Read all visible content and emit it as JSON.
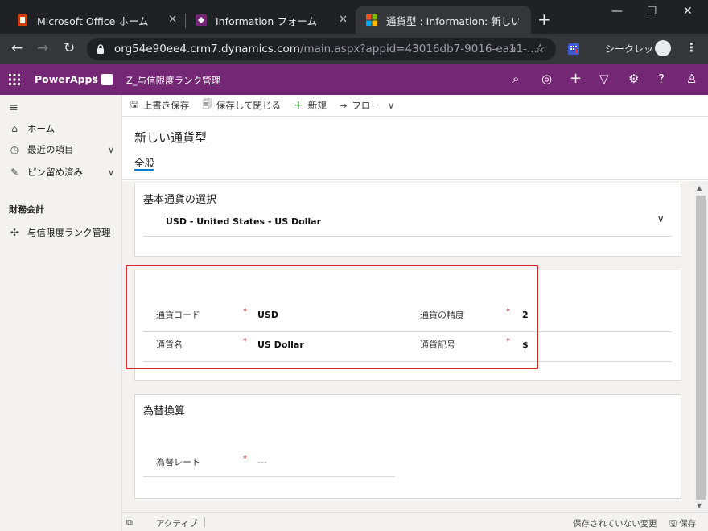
{
  "browser": {
    "tabs": [
      {
        "title": "Microsoft Office ホーム"
      },
      {
        "title": "Information フォーム"
      },
      {
        "title": "通貨型 : Information: 新しい通"
      }
    ],
    "url_host": "org54e90ee4.crm7.dynamics.com",
    "url_path": "/main.aspx?appid=43016db7-9016-ea11-...",
    "incognito_label": "シークレット"
  },
  "app": {
    "brand": "PowerApps",
    "app_name": "Z_与信限度ランク管理"
  },
  "nav": {
    "items": [
      {
        "label": "ホーム"
      },
      {
        "label": "最近の項目"
      },
      {
        "label": "ピン留め済み"
      }
    ],
    "group_title": "財務会計",
    "group_items": [
      {
        "label": "与信限度ランク管理"
      }
    ]
  },
  "commands": {
    "save": "上書き保存",
    "save_close": "保存して閉じる",
    "new": "新規",
    "flow": "フロー"
  },
  "form": {
    "title": "新しい通貨型",
    "tab_general": "全般",
    "base_currency": {
      "title": "基本通貨の選択",
      "value": "USD - United States - US Dollar"
    },
    "details": {
      "currency_code_label": "通貨コード",
      "currency_code_value": "USD",
      "currency_precision_label": "通貨の精度",
      "currency_precision_value": "2",
      "currency_name_label": "通貨名",
      "currency_name_value": "US Dollar",
      "currency_symbol_label": "通貨記号",
      "currency_symbol_value": "$",
      "required_mark": "*"
    },
    "exchange": {
      "title": "為替換算",
      "rate_label": "為替レート",
      "rate_value": "---"
    }
  },
  "footer": {
    "status": "アクティブ",
    "unsaved": "保存されていない変更",
    "save": "保存"
  },
  "colors": {
    "header": "#742774",
    "highlight": "#d7262c",
    "accent": "#0078d4"
  }
}
